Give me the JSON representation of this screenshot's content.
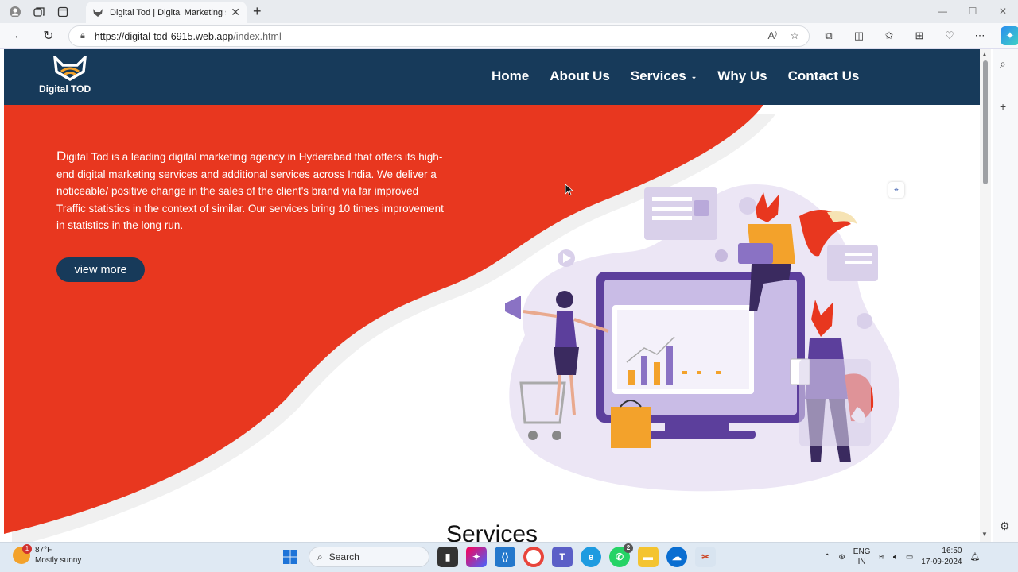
{
  "browser": {
    "tab_title": "Digital Tod | Digital Marketing ser",
    "tab_close": "✕",
    "new_tab": "+",
    "url_host": "https://digital-tod-6915.web.app",
    "url_path": "/index.html",
    "window_controls": [
      "—",
      "☐",
      "✕"
    ]
  },
  "site": {
    "logo_text": "Digital TOD",
    "menu": [
      {
        "label": "Home"
      },
      {
        "label": "About Us"
      },
      {
        "label": "Services"
      },
      {
        "label": "Why Us"
      },
      {
        "label": "Contact Us"
      }
    ],
    "hero": {
      "first_letter": "D",
      "text_rest": "igital Tod is a leading digital marketing agency in Hyderabad that offers its high-end digital marketing services and additional services across India. We deliver a noticeable/ positive change in the sales of the client's brand via far improved Traffic statistics in the context of similar. Our services bring 10 times improvement in statistics in the long run.",
      "button": "view more"
    },
    "section_heading": "Services"
  },
  "taskbar": {
    "temperature": "87°F",
    "weather": "Mostly sunny",
    "weather_badge": "1",
    "search_placeholder": "Search",
    "lang_line1": "ENG",
    "lang_line2": "IN",
    "time": "16:50",
    "date": "17-09-2024",
    "whatsapp_badge": "2"
  },
  "colors": {
    "nav_bg": "#173a5a",
    "hero_red": "#e8371f",
    "button_bg": "#173a5a",
    "illustration_purple": "#5c3f9c"
  }
}
